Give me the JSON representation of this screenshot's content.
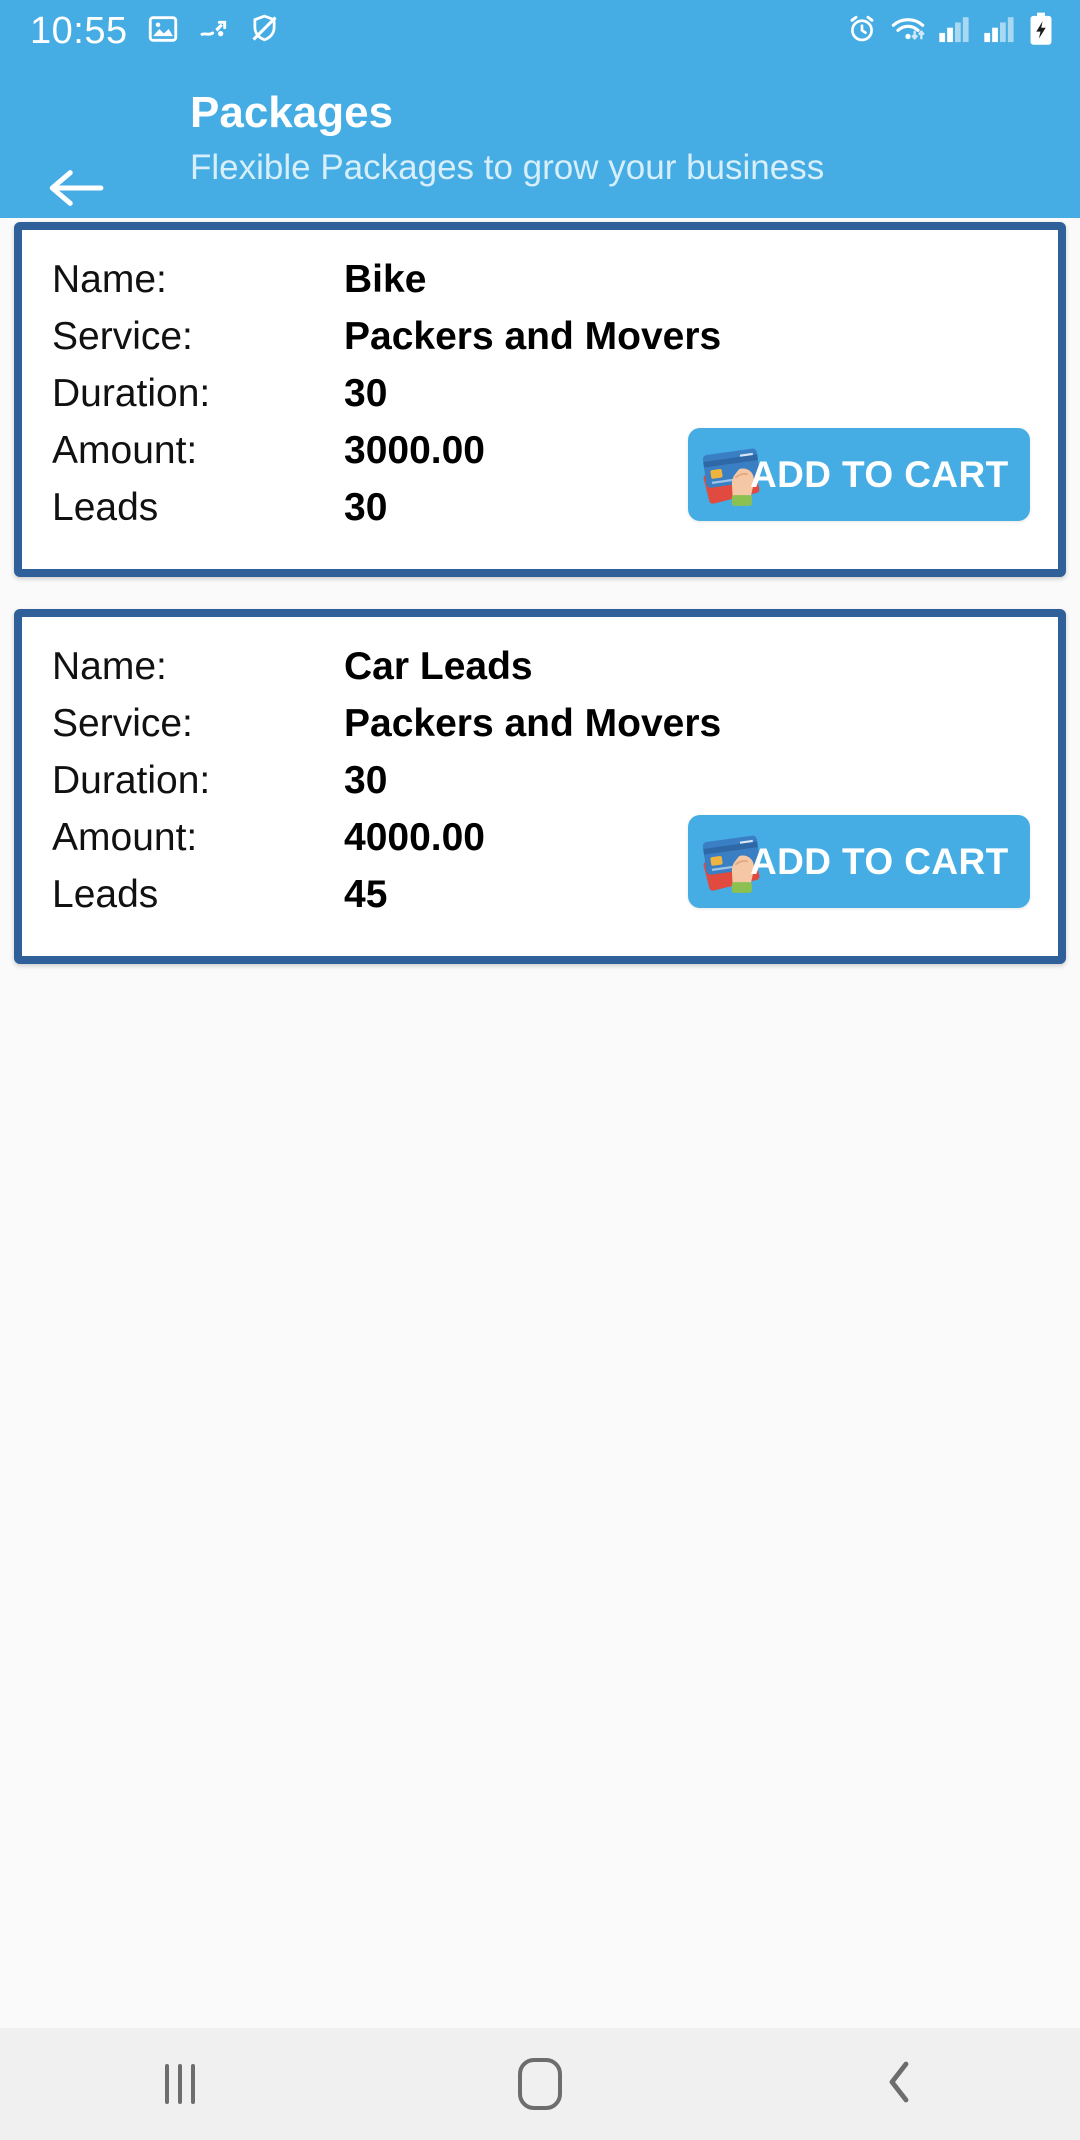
{
  "status_bar": {
    "time": "10:55",
    "left_icons": [
      "image-icon",
      "data-transfer-icon",
      "shield-off-icon"
    ],
    "right_icons": [
      "alarm-clock-icon",
      "wifi-icon",
      "signal-sim1-icon",
      "signal-sim2-icon",
      "battery-charging-icon"
    ]
  },
  "header": {
    "back_icon": "back-arrow-icon",
    "title": "Packages",
    "subtitle": "Flexible Packages to grow your business",
    "background_color": "#45ADE4",
    "title_color": "#FFFFFF",
    "subtitle_color": "#D7EEFB"
  },
  "labels": {
    "name": "Name:",
    "service": "Service:",
    "duration": "Duration:",
    "amount": "Amount:",
    "leads": "Leads"
  },
  "packages": [
    {
      "name": "Bike",
      "service": "Packers and Movers",
      "duration": "30",
      "amount": "3000.00",
      "leads": "30",
      "cart_button_label": "ADD TO CART",
      "cart_button_icon": "credit-card-hand-icon"
    },
    {
      "name": "Car Leads",
      "service": "Packers and Movers",
      "duration": "30",
      "amount": "4000.00",
      "leads": "45",
      "cart_button_label": "ADD TO CART",
      "cart_button_icon": "credit-card-hand-icon"
    }
  ],
  "card_style": {
    "border_color": "#2F6099",
    "background_color": "#FFFFFF",
    "button_color": "#45ADE4"
  },
  "nav_bar": {
    "recents_label": "Recents",
    "home_label": "Home",
    "back_label": "Back",
    "background_color": "#F0F0F0"
  },
  "page": {
    "background_color": "#FAFAFA"
  }
}
